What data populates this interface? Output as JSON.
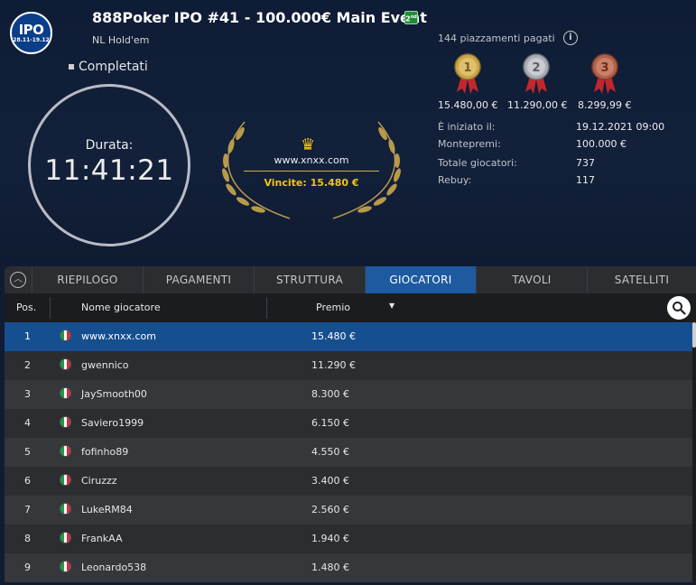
{
  "header": {
    "logo_text": "IPO",
    "logo_dates": "28.11-19.12",
    "title": "888Poker IPO #41 - 100.000€ Main Event",
    "badge": "2nd",
    "game_type": "NL Hold'em",
    "status": "Completati"
  },
  "clock": {
    "label": "Durata:",
    "time": "11:41:21"
  },
  "winner": {
    "name": "www.xnxx.com",
    "winnings": "Vincite: 15.480 €",
    "crown_icon": "crown-icon"
  },
  "payouts": {
    "paid_places": "144 piazzamenti pagati",
    "medals": [
      {
        "rank": "1",
        "value": "15.480,00 €",
        "color": "#c9a64a"
      },
      {
        "rank": "2",
        "value": "11.290,00 €",
        "color": "#a9adb3"
      },
      {
        "rank": "3",
        "value": "8.299,99 €",
        "color": "#b0634a"
      }
    ]
  },
  "info": {
    "started_label": "È iniziato il:",
    "started_value": "19.12.2021   09:00",
    "prizepool_label": "Montepremi:",
    "prizepool_value": "100.000 €",
    "players_label": "Totale giocatori:",
    "players_value": "737",
    "rebuy_label": "Rebuy:",
    "rebuy_value": "117"
  },
  "tabs": [
    {
      "label": "RIEPILOGO",
      "active": false
    },
    {
      "label": "PAGAMENTI",
      "active": false
    },
    {
      "label": "STRUTTURA",
      "active": false
    },
    {
      "label": "GIOCATORI",
      "active": true
    },
    {
      "label": "TAVOLI",
      "active": false
    },
    {
      "label": "SATELLITI",
      "active": false
    }
  ],
  "table": {
    "col_pos": "Pos.",
    "col_name": "Nome giocatore",
    "col_prize": "Premio",
    "rows": [
      {
        "pos": "1",
        "name": "www.xnxx.com",
        "prize": "15.480 €"
      },
      {
        "pos": "2",
        "name": "gwennico",
        "prize": "11.290 €"
      },
      {
        "pos": "3",
        "name": "JaySmooth00",
        "prize": "8.300 €"
      },
      {
        "pos": "4",
        "name": "Saviero1999",
        "prize": "6.150 €"
      },
      {
        "pos": "5",
        "name": "fofinho89",
        "prize": "4.550 €"
      },
      {
        "pos": "6",
        "name": "Ciruzzz",
        "prize": "3.400 €"
      },
      {
        "pos": "7",
        "name": "LukeRM84",
        "prize": "2.560 €"
      },
      {
        "pos": "8",
        "name": "FrankAA",
        "prize": "1.940 €"
      },
      {
        "pos": "9",
        "name": "Leonardo538",
        "prize": "1.480 €"
      }
    ]
  },
  "colors": {
    "accent": "#1d5aa0",
    "gold": "#f0c419",
    "background": "#101c33"
  }
}
